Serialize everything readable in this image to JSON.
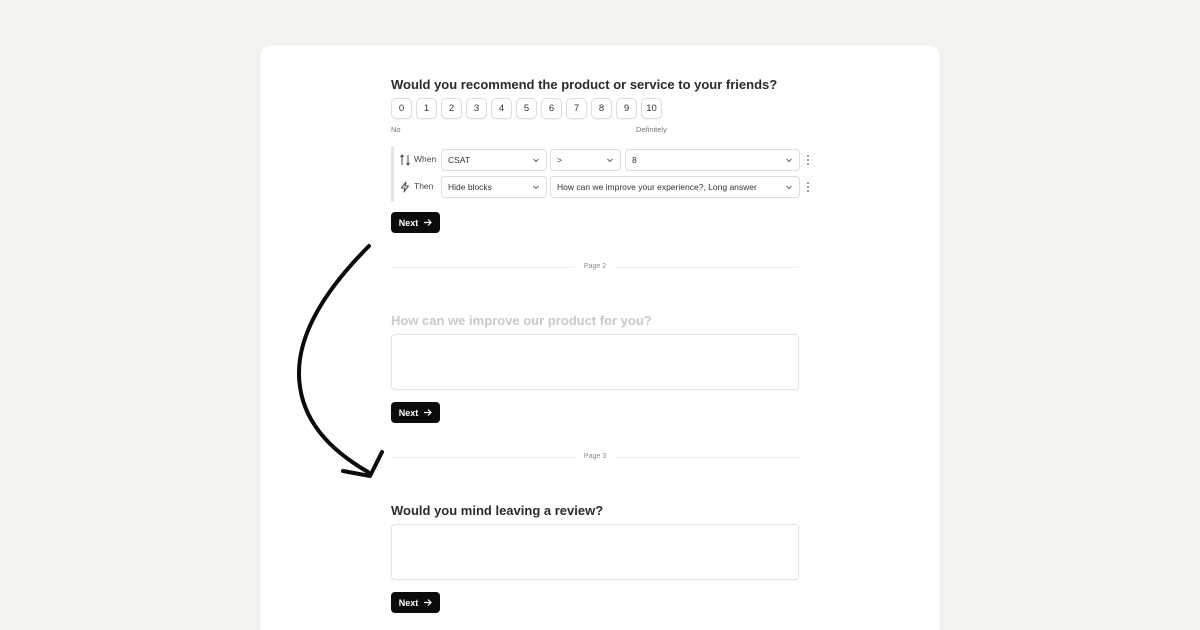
{
  "question1": {
    "title": "Would you recommend the product or service to your friends?",
    "scale": [
      "0",
      "1",
      "2",
      "3",
      "4",
      "5",
      "6",
      "7",
      "8",
      "9",
      "10"
    ],
    "low_label": "No",
    "high_label": "Definitely"
  },
  "logic": {
    "when_label": "When",
    "then_label": "Then",
    "field": "CSAT",
    "operator": ">",
    "value": "8",
    "action": "Hide blocks",
    "target": "How can we improve your experience?, Long answer"
  },
  "next_label": "Next",
  "page2": {
    "label": "Page 2",
    "question": "How can we improve our product for you?"
  },
  "page3": {
    "label": "Page 3",
    "question": "Would you mind leaving a review?"
  },
  "colors": {
    "background": "#f4f2ee",
    "card": "#ffffff",
    "button": "#0b0b0b",
    "muted_text": "#c9c9c9"
  },
  "icons": [
    "branch-icon",
    "bolt-icon",
    "chevron-down-icon",
    "kebab-icon",
    "arrow-right-icon",
    "curved-arrow"
  ]
}
